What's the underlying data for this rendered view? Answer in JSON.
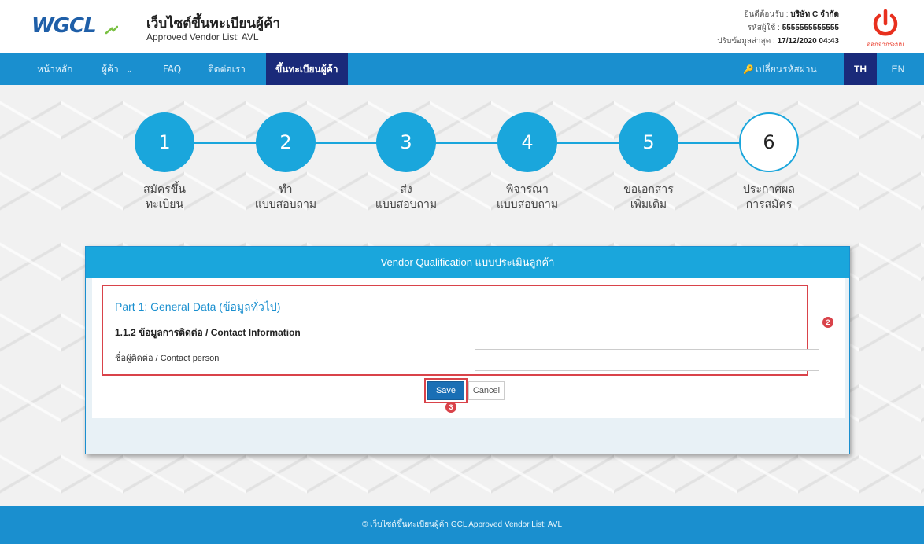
{
  "header": {
    "logo_text": "WGCL",
    "site_title": "เว็บไซต์ขึ้นทะเบียนผู้ค้า",
    "site_subtitle": "Approved Vendor List: AVL",
    "welcome_label": "ยินดีต้อนรับ : ",
    "welcome_value": "บริษัท C จำกัด",
    "user_id_label": "รหัสผู้ใช้ : ",
    "user_id_value": "5555555555555",
    "updated_label": "ปรับข้อมูลล่าสุด : ",
    "updated_value": "17/12/2020 04:43",
    "logout_label": "ออกจากระบบ",
    "logout_icon": "power-icon",
    "accent_color": "#1a8fcf",
    "logout_color": "#e8301e"
  },
  "nav": {
    "items": [
      {
        "label": "หน้าหลัก"
      },
      {
        "label": "ผู้ค้า"
      },
      {
        "label": "FAQ"
      },
      {
        "label": "ติดต่อเรา"
      },
      {
        "label": "ขึ้นทะเบียนผู้ค้า"
      }
    ],
    "vendor_dropdown_icon": "chevron-down-icon",
    "change_password": "เปลี่ยนรหัสผ่าน",
    "change_password_icon": "key-icon",
    "lang_th": "TH",
    "lang_en": "EN"
  },
  "steps": [
    {
      "number": "1",
      "line1": "สมัครขึ้น",
      "line2": "ทะเบียน"
    },
    {
      "number": "2",
      "line1": "ทำ",
      "line2": "แบบสอบถาม"
    },
    {
      "number": "3",
      "line1": "ส่ง",
      "line2": "แบบสอบถาม"
    },
    {
      "number": "4",
      "line1": "พิจารณา",
      "line2": "แบบสอบถาม"
    },
    {
      "number": "5",
      "line1": "ขอเอกสาร",
      "line2": "เพิ่มเติม"
    },
    {
      "number": "6",
      "line1": "ประกาศผล",
      "line2": "การสมัคร"
    }
  ],
  "form": {
    "panel_title": "Vendor Qualification แบบประเมินลูกค้า",
    "part_title": "Part 1: General Data (ข้อมูลทั่วไป)",
    "section_title": "1.1.2 ข้อมูลการติดต่อ / Contact Information",
    "contact_label": "ชื่อผู้ติดต่อ / Contact person",
    "contact_value": "",
    "save_label": "Save",
    "cancel_label": "Cancel",
    "badge_2": "2",
    "badge_3": "3"
  },
  "footer": {
    "text": "© เว็บไซต์ขึ้นทะเบียนผู้ค้า GCL Approved Vendor List: AVL"
  }
}
